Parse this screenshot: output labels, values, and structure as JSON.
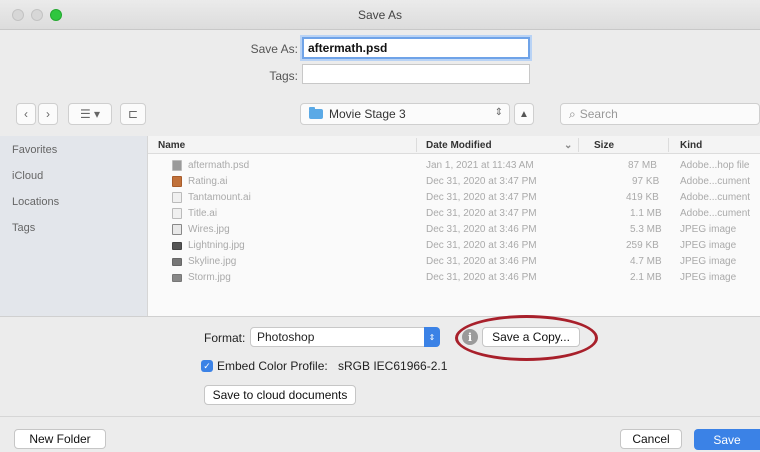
{
  "window": {
    "title": "Save As"
  },
  "form": {
    "save_as_label": "Save As:",
    "save_as_value": "aftermath.psd",
    "tags_label": "Tags:",
    "tags_value": ""
  },
  "toolbar": {
    "location": "Movie Stage 3",
    "search_placeholder": "Search"
  },
  "sidebar": {
    "items": [
      "Favorites",
      "iCloud",
      "Locations",
      "Tags"
    ]
  },
  "file_list": {
    "columns": [
      "Name",
      "Date Modified",
      "Size",
      "Kind"
    ],
    "rows": [
      {
        "name": "aftermath.psd",
        "date": "Jan 1, 2021 at 11:43 AM",
        "size": "87 MB",
        "kind": "Adobe...hop file"
      },
      {
        "name": "Rating.ai",
        "date": "Dec 31, 2020 at 3:47 PM",
        "size": "97 KB",
        "kind": "Adobe...cument"
      },
      {
        "name": "Tantamount.ai",
        "date": "Dec 31, 2020 at 3:47 PM",
        "size": "419 KB",
        "kind": "Adobe...cument"
      },
      {
        "name": "Title.ai",
        "date": "Dec 31, 2020 at 3:47 PM",
        "size": "1.1 MB",
        "kind": "Adobe...cument"
      },
      {
        "name": "Wires.jpg",
        "date": "Dec 31, 2020 at 3:46 PM",
        "size": "5.3 MB",
        "kind": "JPEG image"
      },
      {
        "name": "Lightning.jpg",
        "date": "Dec 31, 2020 at 3:46 PM",
        "size": "259 KB",
        "kind": "JPEG image"
      },
      {
        "name": "Skyline.jpg",
        "date": "Dec 31, 2020 at 3:46 PM",
        "size": "4.7 MB",
        "kind": "JPEG image"
      },
      {
        "name": "Storm.jpg",
        "date": "Dec 31, 2020 at 3:46 PM",
        "size": "2.1 MB",
        "kind": "JPEG image"
      }
    ]
  },
  "options": {
    "format_label": "Format:",
    "format_value": "Photoshop",
    "save_copy_label": "Save a Copy...",
    "embed_label": "Embed Color Profile:",
    "embed_profile": "sRGB IEC61966-2.1",
    "embed_checked": true,
    "cloud_label": "Save to cloud documents"
  },
  "footer": {
    "new_folder_label": "New Folder",
    "cancel_label": "Cancel",
    "save_label": "Save"
  },
  "colors": {
    "accent": "#3b82e6",
    "highlight_ring": "#a8202b"
  }
}
